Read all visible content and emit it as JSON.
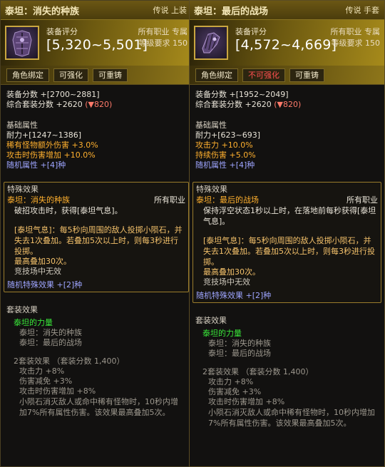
{
  "cards": [
    {
      "title": "泰坦：消失的种族",
      "tag": "传说 上装",
      "score_label": "装备评分",
      "score_value": "[5,320~5,501]",
      "class_label": "所有职业 专属",
      "level_req": "等级要求 150",
      "tags": [
        "角色绑定",
        "可强化",
        "可重铸"
      ],
      "score_line": "装备分数 +[2700~2881]",
      "set_score_line": "综合套装分数 +2620",
      "set_score_delta": "(▼820)",
      "base_heading": "基础属性",
      "base_stats": [
        {
          "text": "耐力+[1247~1386]",
          "color": "white"
        },
        {
          "text": "稀有怪物额外伤害 +3.0%",
          "color": "orange"
        },
        {
          "text": "攻击时伤害增加 +10.0%",
          "color": "orange"
        },
        {
          "text": "随机属性 +[4]种",
          "color": "blue"
        }
      ],
      "special_heading": "特殊效果",
      "effect_name": "泰坦：消失的种族",
      "effect_class": "所有职业",
      "effect_desc": "破招攻击时，获得[泰坦气息]。",
      "aura_desc": "[泰坦气息]：每5秒向周围的敌人投掷小陨石，并失去1次叠加。若叠加5次以上时，则每3秒进行投掷。",
      "max_stack": "最高叠加30次。",
      "arena": "竞技场中无效",
      "random_special": "随机特殊效果 +[2]种",
      "set_heading": "套装效果",
      "set_name": "泰坦的力量",
      "set_items": [
        "泰坦：消失的种族",
        "泰坦：最后的战场"
      ],
      "set_bonus_title": "2套装效果 （套装分数 1,400）",
      "set_bonus_lines": [
        "攻击力 +8%",
        "伤害减免 +3%",
        "攻击时伤害增加 +8%"
      ],
      "set_bonus_desc": "小陨石消灭敌人或命中稀有怪物时，10秒内增加7%所有属性伤害。该效果最高叠加5次。"
    },
    {
      "title": "泰坦：最后的战场",
      "tag": "传说 手套",
      "score_label": "装备评分",
      "score_value": "[4,572~4,669]",
      "class_label": "所有职业 专属",
      "level_req": "等级要求 150",
      "tags": [
        "角色绑定",
        "不可强化",
        "可重铸"
      ],
      "score_line": "装备分数 +[1952~2049]",
      "set_score_line": "综合套装分数 +2620",
      "set_score_delta": "(▼820)",
      "base_heading": "基础属性",
      "base_stats": [
        {
          "text": "耐力+[623~693]",
          "color": "white"
        },
        {
          "text": "攻击力 +10.0%",
          "color": "orange"
        },
        {
          "text": "持续伤害 +5.0%",
          "color": "orange"
        },
        {
          "text": "随机属性 +[4]种",
          "color": "blue"
        }
      ],
      "special_heading": "特殊效果",
      "effect_name": "泰坦：最后的战场",
      "effect_class": "所有职业",
      "effect_desc": "保持浮空状态1秒以上时，在落地前每秒获得[泰坦气息]。",
      "aura_desc": "[泰坦气息]：每5秒向周围的敌人投掷小陨石，并失去1次叠加。若叠加5次以上时，则每3秒进行投掷。",
      "max_stack": "最高叠加30次。",
      "arena": "竞技场中无效",
      "random_special": "随机特殊效果 +[2]种",
      "set_heading": "套装效果",
      "set_name": "泰坦的力量",
      "set_items": [
        "泰坦：消失的种族",
        "泰坦：最后的战场"
      ],
      "set_bonus_title": "2套装效果 （套装分数 1,400）",
      "set_bonus_lines": [
        "攻击力 +8%",
        "伤害减免 +3%",
        "攻击时伤害增加 +8%"
      ],
      "set_bonus_desc": "小陨石消灭敌人或命中稀有怪物时，10秒内增加7%所有属性伤害。该效果最高叠加5次。"
    }
  ]
}
